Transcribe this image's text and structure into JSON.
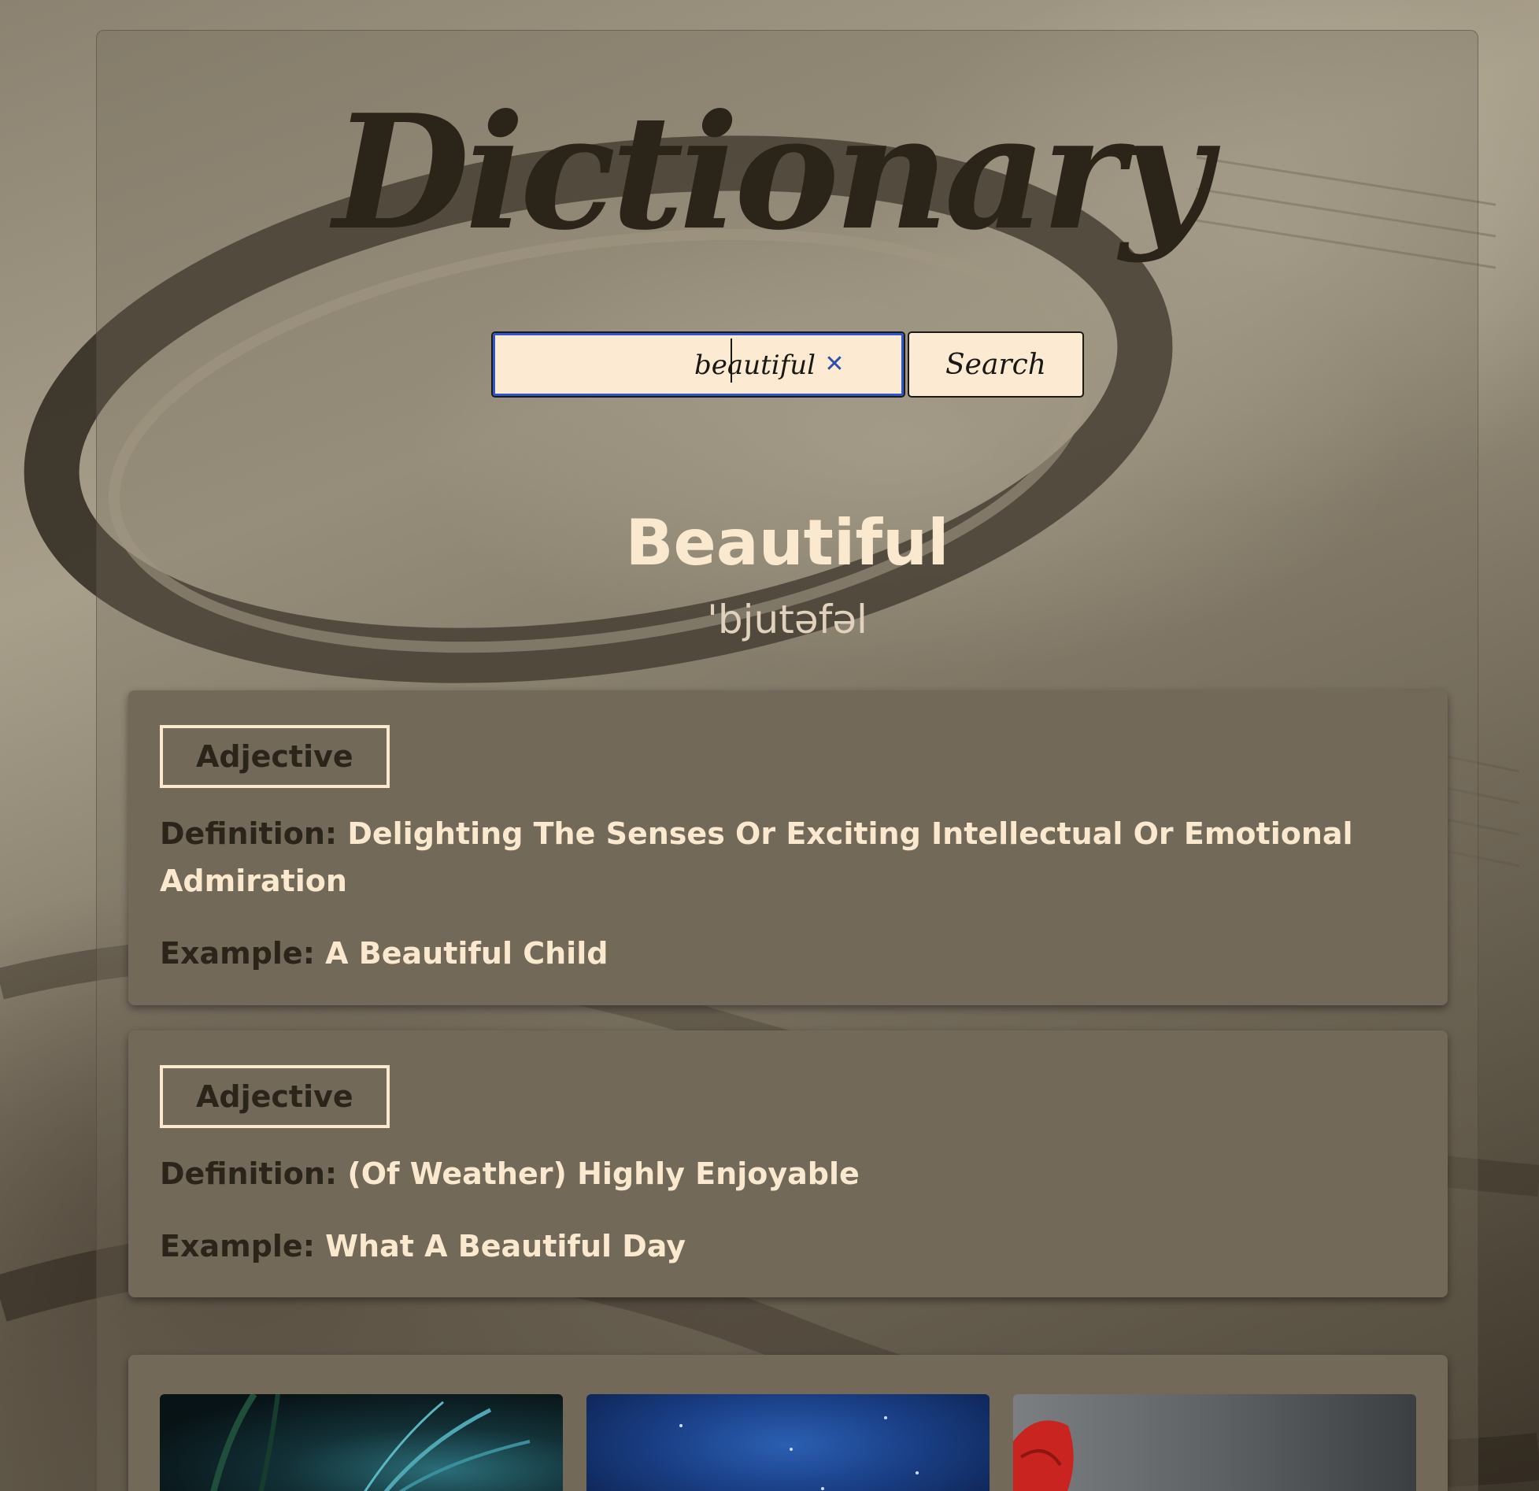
{
  "app": {
    "logo_text": "Dictionary"
  },
  "search": {
    "value": "beautiful",
    "clear_icon": "close-icon",
    "button_label": "Search"
  },
  "result": {
    "word": "Beautiful",
    "phonetic": "'bjutəfəl",
    "meanings": [
      {
        "part_of_speech": "Adjective",
        "definition_label": "Definition:",
        "definition": "Delighting The Senses Or Exciting Intellectual Or Emotional Admiration",
        "example_label": "Example:",
        "example": "A Beautiful Child"
      },
      {
        "part_of_speech": "Adjective",
        "definition_label": "Definition:",
        "definition": "(Of Weather) Highly Enjoyable",
        "example_label": "Example:",
        "example": "What A Beautiful Day"
      }
    ]
  },
  "colors": {
    "cream": "#fbe9cf",
    "dark_brown": "#2b2419",
    "panel": "#726959",
    "focus_ring": "#2f56c9"
  }
}
